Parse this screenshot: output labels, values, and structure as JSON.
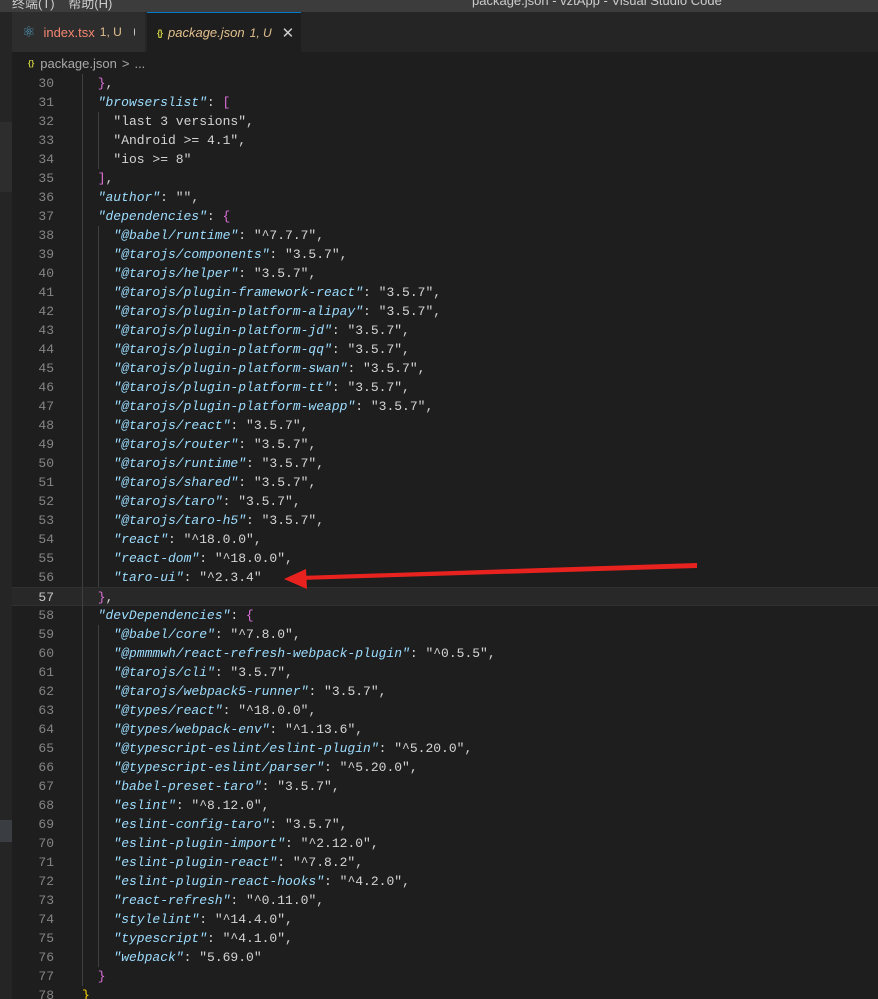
{
  "window": {
    "menu": [
      "终端(T)",
      "帮助(H)"
    ],
    "title": "package.json - vztApp - Visual Studio Code"
  },
  "tabs": [
    {
      "name": "index.tsx",
      "status": "1, U",
      "dirty": true,
      "icon": "react-icon"
    },
    {
      "name": "package.json",
      "status": "1, U",
      "active": true,
      "icon": "json-icon"
    }
  ],
  "breadcrumb": {
    "file": "package.json",
    "separator": ">",
    "rest": "..."
  },
  "editor": {
    "current_line": 57,
    "lines": [
      {
        "n": 30,
        "indent": 1,
        "text": "},"
      },
      {
        "n": 31,
        "indent": 1,
        "key": "browserslist",
        "open": "["
      },
      {
        "n": 32,
        "indent": 2,
        "str": "last 3 versions",
        "comma": true
      },
      {
        "n": 33,
        "indent": 2,
        "str": "Android >= 4.1",
        "comma": true
      },
      {
        "n": 34,
        "indent": 2,
        "str": "ios >= 8"
      },
      {
        "n": 35,
        "indent": 1,
        "text": "],"
      },
      {
        "n": 36,
        "indent": 1,
        "key": "author",
        "value": "",
        "comma": true
      },
      {
        "n": 37,
        "indent": 1,
        "key": "dependencies",
        "open": "{"
      },
      {
        "n": 38,
        "indent": 2,
        "key": "@babel/runtime",
        "value": "^7.7.7",
        "comma": true
      },
      {
        "n": 39,
        "indent": 2,
        "key": "@tarojs/components",
        "value": "3.5.7",
        "comma": true
      },
      {
        "n": 40,
        "indent": 2,
        "key": "@tarojs/helper",
        "value": "3.5.7",
        "comma": true
      },
      {
        "n": 41,
        "indent": 2,
        "key": "@tarojs/plugin-framework-react",
        "value": "3.5.7",
        "comma": true
      },
      {
        "n": 42,
        "indent": 2,
        "key": "@tarojs/plugin-platform-alipay",
        "value": "3.5.7",
        "comma": true
      },
      {
        "n": 43,
        "indent": 2,
        "key": "@tarojs/plugin-platform-jd",
        "value": "3.5.7",
        "comma": true
      },
      {
        "n": 44,
        "indent": 2,
        "key": "@tarojs/plugin-platform-qq",
        "value": "3.5.7",
        "comma": true
      },
      {
        "n": 45,
        "indent": 2,
        "key": "@tarojs/plugin-platform-swan",
        "value": "3.5.7",
        "comma": true
      },
      {
        "n": 46,
        "indent": 2,
        "key": "@tarojs/plugin-platform-tt",
        "value": "3.5.7",
        "comma": true
      },
      {
        "n": 47,
        "indent": 2,
        "key": "@tarojs/plugin-platform-weapp",
        "value": "3.5.7",
        "comma": true
      },
      {
        "n": 48,
        "indent": 2,
        "key": "@tarojs/react",
        "value": "3.5.7",
        "comma": true
      },
      {
        "n": 49,
        "indent": 2,
        "key": "@tarojs/router",
        "value": "3.5.7",
        "comma": true
      },
      {
        "n": 50,
        "indent": 2,
        "key": "@tarojs/runtime",
        "value": "3.5.7",
        "comma": true
      },
      {
        "n": 51,
        "indent": 2,
        "key": "@tarojs/shared",
        "value": "3.5.7",
        "comma": true
      },
      {
        "n": 52,
        "indent": 2,
        "key": "@tarojs/taro",
        "value": "3.5.7",
        "comma": true
      },
      {
        "n": 53,
        "indent": 2,
        "key": "@tarojs/taro-h5",
        "value": "3.5.7",
        "comma": true
      },
      {
        "n": 54,
        "indent": 2,
        "key": "react",
        "value": "^18.0.0",
        "comma": true
      },
      {
        "n": 55,
        "indent": 2,
        "key": "react-dom",
        "value": "^18.0.0",
        "comma": true
      },
      {
        "n": 56,
        "indent": 2,
        "key": "taro-ui",
        "value": "^2.3.4"
      },
      {
        "n": 57,
        "indent": 1,
        "text": "},"
      },
      {
        "n": 58,
        "indent": 1,
        "key": "devDependencies",
        "open": "{"
      },
      {
        "n": 59,
        "indent": 2,
        "key": "@babel/core",
        "value": "^7.8.0",
        "comma": true
      },
      {
        "n": 60,
        "indent": 2,
        "key": "@pmmmwh/react-refresh-webpack-plugin",
        "value": "^0.5.5",
        "comma": true
      },
      {
        "n": 61,
        "indent": 2,
        "key": "@tarojs/cli",
        "value": "3.5.7",
        "comma": true
      },
      {
        "n": 62,
        "indent": 2,
        "key": "@tarojs/webpack5-runner",
        "value": "3.5.7",
        "comma": true
      },
      {
        "n": 63,
        "indent": 2,
        "key": "@types/react",
        "value": "^18.0.0",
        "comma": true
      },
      {
        "n": 64,
        "indent": 2,
        "key": "@types/webpack-env",
        "value": "^1.13.6",
        "comma": true
      },
      {
        "n": 65,
        "indent": 2,
        "key": "@typescript-eslint/eslint-plugin",
        "value": "^5.20.0",
        "comma": true
      },
      {
        "n": 66,
        "indent": 2,
        "key": "@typescript-eslint/parser",
        "value": "^5.20.0",
        "comma": true
      },
      {
        "n": 67,
        "indent": 2,
        "key": "babel-preset-taro",
        "value": "3.5.7",
        "comma": true
      },
      {
        "n": 68,
        "indent": 2,
        "key": "eslint",
        "value": "^8.12.0",
        "comma": true
      },
      {
        "n": 69,
        "indent": 2,
        "key": "eslint-config-taro",
        "value": "3.5.7",
        "comma": true
      },
      {
        "n": 70,
        "indent": 2,
        "key": "eslint-plugin-import",
        "value": "^2.12.0",
        "comma": true
      },
      {
        "n": 71,
        "indent": 2,
        "key": "eslint-plugin-react",
        "value": "^7.8.2",
        "comma": true
      },
      {
        "n": 72,
        "indent": 2,
        "key": "eslint-plugin-react-hooks",
        "value": "^4.2.0",
        "comma": true
      },
      {
        "n": 73,
        "indent": 2,
        "key": "react-refresh",
        "value": "^0.11.0",
        "comma": true
      },
      {
        "n": 74,
        "indent": 2,
        "key": "stylelint",
        "value": "^14.4.0",
        "comma": true
      },
      {
        "n": 75,
        "indent": 2,
        "key": "typescript",
        "value": "^4.1.0",
        "comma": true
      },
      {
        "n": 76,
        "indent": 2,
        "key": "webpack",
        "value": "5.69.0"
      },
      {
        "n": 77,
        "indent": 1,
        "text": "}"
      },
      {
        "n": 78,
        "indent": 0,
        "text": "}"
      }
    ]
  },
  "annotation": {
    "type": "red-arrow",
    "points_to_line": 56,
    "color": "#e8231f"
  },
  "colors": {
    "key": "#9cdcfe",
    "string": "#ce9178",
    "bracket_gold": "#ffd700",
    "bracket_purple": "#da70d6",
    "bracket_blue": "#179fff"
  }
}
